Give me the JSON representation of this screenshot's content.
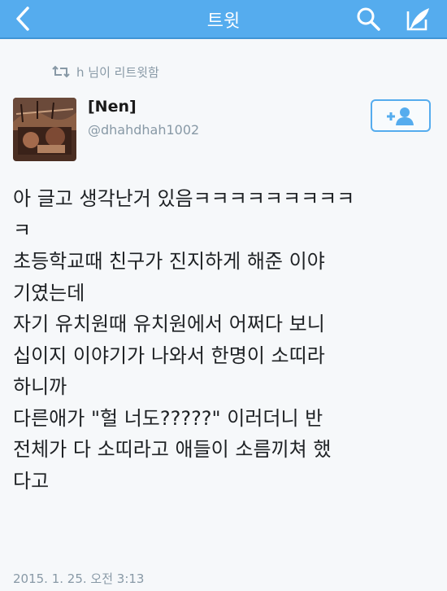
{
  "header": {
    "title": "트윗",
    "bg_color": "#55acee",
    "back_icon": "chevron-left-icon",
    "search_icon": "search-icon",
    "compose_icon": "compose-icon"
  },
  "retweet": {
    "icon": "retweet-icon",
    "text": "h 님이 리트윗함"
  },
  "author": {
    "name": "[Nen]",
    "handle": "@dhahdhah1002",
    "follow_icon": "follow-user-icon"
  },
  "tweet": {
    "lines": [
      "아 글고 생각난거 있음ㅋㅋㅋㅋㅋㅋㅋㅋㅋ",
      "ㅋ",
      "초등학교때 친구가 진지하게 해준 이야",
      "기였는데",
      "자기 유치원때 유치원에서 어쩌다 보니",
      "십이지 이야기가 나와서 한명이 소띠라",
      "하니까",
      "다른애가 \"헐 너도?????\" 이러더니 반",
      "전체가 다 소띠라고 애들이 소름끼쳐 했",
      "다고"
    ],
    "timestamp": "2015. 1. 25. 오전 3:13"
  }
}
